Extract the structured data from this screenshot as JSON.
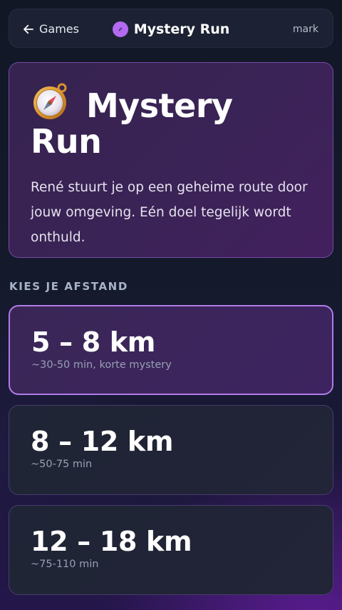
{
  "header": {
    "back_label": "Games",
    "title": "Mystery Run",
    "user": "mark"
  },
  "hero": {
    "title_line1": "Mystery",
    "title_line2": "Run",
    "icon": "compass-icon",
    "description": "René stuurt je op een geheime route door jouw omgeving. Eén doel tegelijk wordt onthuld."
  },
  "distance": {
    "section_label": "KIES JE AFSTAND",
    "options": [
      {
        "label": "5 – 8 km",
        "subtitle": "~30-50 min, korte mystery",
        "selected": true
      },
      {
        "label": "8 – 12 km",
        "subtitle": "~50-75 min",
        "selected": false
      },
      {
        "label": "12 – 18 km",
        "subtitle": "~75-110 min",
        "selected": false
      }
    ]
  },
  "colors": {
    "accent": "#b07be8",
    "compass": "#b36af0"
  }
}
